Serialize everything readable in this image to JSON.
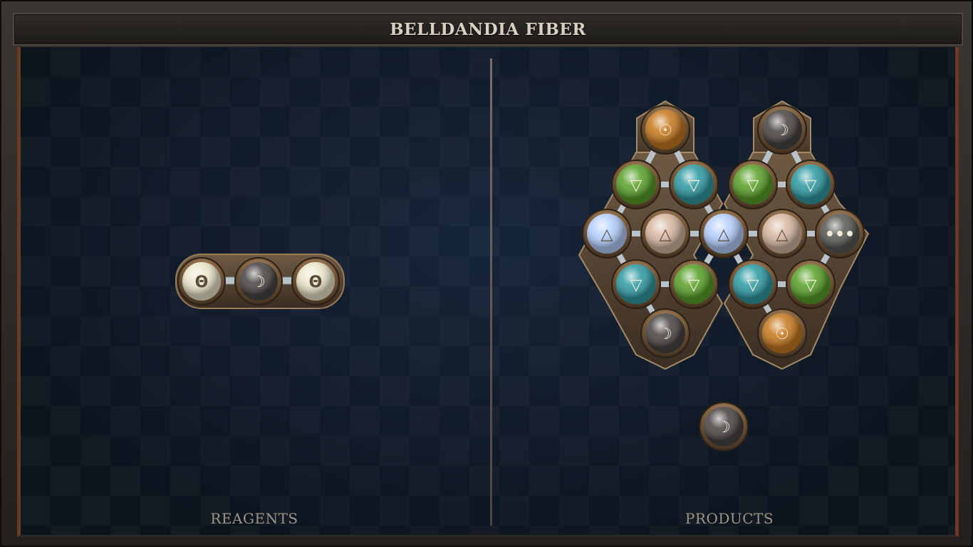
{
  "window": {
    "title": "BELLDANDIA FIBER"
  },
  "sections": {
    "reagents_label": "REAGENTS",
    "products_label": "PRODUCTS"
  },
  "reagents": {
    "atoms": [
      {
        "element": "salt",
        "glyph": "Θ",
        "color": "#ece7cc"
      },
      {
        "element": "lead",
        "glyph": "☽",
        "color": "#4a4644"
      },
      {
        "element": "salt",
        "glyph": "Θ",
        "color": "#ece7cc"
      }
    ]
  },
  "products": {
    "molecules": [
      {
        "atoms": [
          {
            "element": "gold",
            "glyph": "☉",
            "color": "#c87a20"
          },
          {
            "element": "earth",
            "glyph": "▽",
            "color": "#5aa12a"
          },
          {
            "element": "water",
            "glyph": "▽",
            "color": "#2f9ba3"
          },
          {
            "element": "air",
            "glyph": "△",
            "color": "#b6d0ff"
          },
          {
            "element": "fire",
            "glyph": "△",
            "color": "#d8b8a2"
          },
          {
            "element": "water",
            "glyph": "▽",
            "color": "#2f9ba3"
          },
          {
            "element": "earth",
            "glyph": "▽",
            "color": "#5aa12a"
          },
          {
            "element": "lead",
            "glyph": "☽",
            "color": "#4a4644"
          },
          {
            "element": "air",
            "glyph": "△",
            "color": "#b6d0ff"
          }
        ]
      },
      {
        "atoms": [
          {
            "element": "lead",
            "glyph": "☽",
            "color": "#4a4644"
          },
          {
            "element": "earth",
            "glyph": "▽",
            "color": "#5aa12a"
          },
          {
            "element": "water",
            "glyph": "▽",
            "color": "#2f9ba3"
          },
          {
            "element": "fire",
            "glyph": "△",
            "color": "#d8b8a2"
          },
          {
            "element": "repeat",
            "glyph": "•••",
            "color": "#5a5a56"
          },
          {
            "element": "water",
            "glyph": "▽",
            "color": "#2f9ba3"
          },
          {
            "element": "earth",
            "glyph": "▽",
            "color": "#5aa12a"
          },
          {
            "element": "gold",
            "glyph": "☉",
            "color": "#c87a20"
          }
        ]
      },
      {
        "atoms": [
          {
            "element": "lead",
            "glyph": "☽",
            "color": "#4a4644"
          }
        ]
      }
    ]
  },
  "colors": {
    "frame": "#2a2622",
    "board": "#0f1722",
    "accent_border": "#6b3a22",
    "metal_ring": "#8a7255",
    "bond": "#b9c3c9"
  }
}
